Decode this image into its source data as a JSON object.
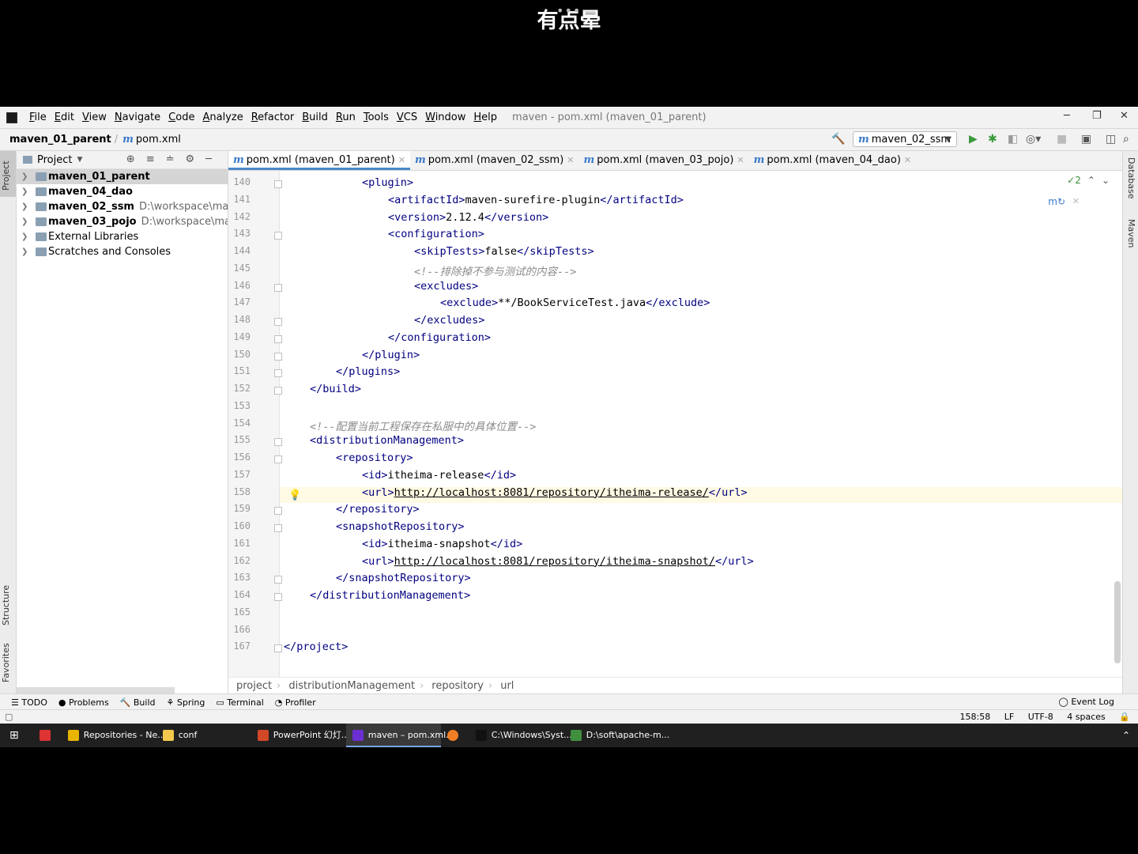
{
  "overlay": {
    "title": "有点晕",
    "dots": "•••"
  },
  "window": {
    "title": "maven - pom.xml (maven_01_parent)",
    "controls": {
      "minimize": "─",
      "restore": "❐",
      "close": "✕"
    }
  },
  "menu": [
    "File",
    "Edit",
    "View",
    "Navigate",
    "Code",
    "Analyze",
    "Refactor",
    "Build",
    "Run",
    "Tools",
    "VCS",
    "Window",
    "Help"
  ],
  "navbar": {
    "project": "maven_01_parent",
    "file": "pom.xml",
    "run_config": "maven_02_ssm"
  },
  "left_strip": {
    "project": "Project",
    "structure": "Structure",
    "favorites": "Favorites"
  },
  "right_strip": {
    "database": "Database",
    "maven": "Maven"
  },
  "project_panel": {
    "title": "Project",
    "items": [
      {
        "name": "maven_01_parent",
        "path": ""
      },
      {
        "name": "maven_04_dao",
        "path": ""
      },
      {
        "name": "maven_02_ssm",
        "path": "D:\\workspace\\maven\\r"
      },
      {
        "name": "maven_03_pojo",
        "path": "D:\\workspace\\maven\\"
      },
      {
        "name": "External Libraries",
        "path": ""
      },
      {
        "name": "Scratches and Consoles",
        "path": ""
      }
    ]
  },
  "tabs": [
    {
      "label": "pom.xml (maven_01_parent)",
      "active": true
    },
    {
      "label": "pom.xml (maven_02_ssm)",
      "active": false
    },
    {
      "label": "pom.xml (maven_03_pojo)",
      "active": false
    },
    {
      "label": "pom.xml (maven_04_dao)",
      "active": false
    }
  ],
  "editor": {
    "inspections": "✓2",
    "lines": [
      {
        "n": "140",
        "indent": 3,
        "segs": [
          [
            "t",
            "<plugin>"
          ]
        ]
      },
      {
        "n": "141",
        "indent": 4,
        "segs": [
          [
            "t",
            "<artifactId>"
          ],
          [
            "v",
            "maven-surefire-plugin"
          ],
          [
            "t",
            "</artifactId>"
          ]
        ]
      },
      {
        "n": "142",
        "indent": 4,
        "segs": [
          [
            "t",
            "<version>"
          ],
          [
            "v",
            "2.12.4"
          ],
          [
            "t",
            "</version>"
          ]
        ]
      },
      {
        "n": "143",
        "indent": 4,
        "segs": [
          [
            "t",
            "<configuration>"
          ]
        ]
      },
      {
        "n": "144",
        "indent": 5,
        "segs": [
          [
            "t",
            "<skipTests>"
          ],
          [
            "v",
            "false"
          ],
          [
            "t",
            "</skipTests>"
          ]
        ]
      },
      {
        "n": "145",
        "indent": 5,
        "segs": [
          [
            "c",
            "<!--排除掉不参与测试的内容-->"
          ]
        ]
      },
      {
        "n": "146",
        "indent": 5,
        "segs": [
          [
            "t",
            "<excludes>"
          ]
        ]
      },
      {
        "n": "147",
        "indent": 6,
        "segs": [
          [
            "t",
            "<exclude>"
          ],
          [
            "v",
            "**/BookServiceTest.java"
          ],
          [
            "t",
            "</exclude>"
          ]
        ]
      },
      {
        "n": "148",
        "indent": 5,
        "segs": [
          [
            "t",
            "</excludes>"
          ]
        ]
      },
      {
        "n": "149",
        "indent": 4,
        "segs": [
          [
            "t",
            "</configuration>"
          ]
        ]
      },
      {
        "n": "150",
        "indent": 3,
        "segs": [
          [
            "t",
            "</plugin>"
          ]
        ]
      },
      {
        "n": "151",
        "indent": 2,
        "segs": [
          [
            "t",
            "</plugins>"
          ]
        ]
      },
      {
        "n": "152",
        "indent": 1,
        "segs": [
          [
            "t",
            "</build>"
          ]
        ]
      },
      {
        "n": "153",
        "indent": 0,
        "segs": []
      },
      {
        "n": "154",
        "indent": 1,
        "segs": [
          [
            "c",
            "<!--配置当前工程保存在私服中的具体位置-->"
          ]
        ]
      },
      {
        "n": "155",
        "indent": 1,
        "segs": [
          [
            "t",
            "<distributionManagement>"
          ]
        ]
      },
      {
        "n": "156",
        "indent": 2,
        "segs": [
          [
            "t",
            "<repository>"
          ]
        ]
      },
      {
        "n": "157",
        "indent": 3,
        "segs": [
          [
            "t",
            "<id>"
          ],
          [
            "v",
            "itheima-release"
          ],
          [
            "t",
            "</id>"
          ]
        ]
      },
      {
        "n": "158",
        "indent": 3,
        "segs": [
          [
            "t",
            "<url>"
          ],
          [
            "u",
            "http://localhost:8081/repository/itheima-release/"
          ],
          [
            "t",
            "</url>"
          ]
        ]
      },
      {
        "n": "159",
        "indent": 2,
        "segs": [
          [
            "t",
            "</repository>"
          ]
        ]
      },
      {
        "n": "160",
        "indent": 2,
        "segs": [
          [
            "t",
            "<snapshotRepository>"
          ]
        ]
      },
      {
        "n": "161",
        "indent": 3,
        "segs": [
          [
            "t",
            "<id>"
          ],
          [
            "v",
            "itheima-snapshot"
          ],
          [
            "t",
            "</id>"
          ]
        ]
      },
      {
        "n": "162",
        "indent": 3,
        "segs": [
          [
            "t",
            "<url>"
          ],
          [
            "u",
            "http://localhost:8081/repository/itheima-snapshot/"
          ],
          [
            "t",
            "</url>"
          ]
        ]
      },
      {
        "n": "163",
        "indent": 2,
        "segs": [
          [
            "t",
            "</snapshotRepository>"
          ]
        ]
      },
      {
        "n": "164",
        "indent": 1,
        "segs": [
          [
            "t",
            "</distributionManagement>"
          ]
        ]
      },
      {
        "n": "165",
        "indent": 0,
        "segs": []
      },
      {
        "n": "166",
        "indent": 0,
        "segs": []
      },
      {
        "n": "167",
        "indent": 0,
        "segs": [
          [
            "t",
            "</project>"
          ]
        ]
      }
    ],
    "breadcrumb": [
      "project",
      "distributionManagement",
      "repository",
      "url"
    ]
  },
  "tool_windows": [
    "TODO",
    "Problems",
    "Build",
    "Spring",
    "Terminal",
    "Profiler"
  ],
  "event_log": "Event Log",
  "status": {
    "position": "158:58",
    "line_sep": "LF",
    "encoding": "UTF-8",
    "indent": "4 spaces"
  },
  "taskbar": [
    {
      "label": "",
      "color": "#d33",
      "active": false
    },
    {
      "label": "Repositories - Ne...",
      "color": "#e8b400",
      "active": false
    },
    {
      "label": "conf",
      "color": "#f2c94c",
      "active": false
    },
    {
      "label": "PowerPoint 幻灯...",
      "color": "#d24726",
      "active": false
    },
    {
      "label": "maven – pom.xml...",
      "color": "#6b2fd1",
      "active": true
    },
    {
      "label": "",
      "color": "#f07e25",
      "active": false
    },
    {
      "label": "C:\\Windows\\Syst...",
      "color": "#111",
      "active": false
    },
    {
      "label": "D:\\soft\\apache-m...",
      "color": "#3f8f3f",
      "active": false
    }
  ]
}
